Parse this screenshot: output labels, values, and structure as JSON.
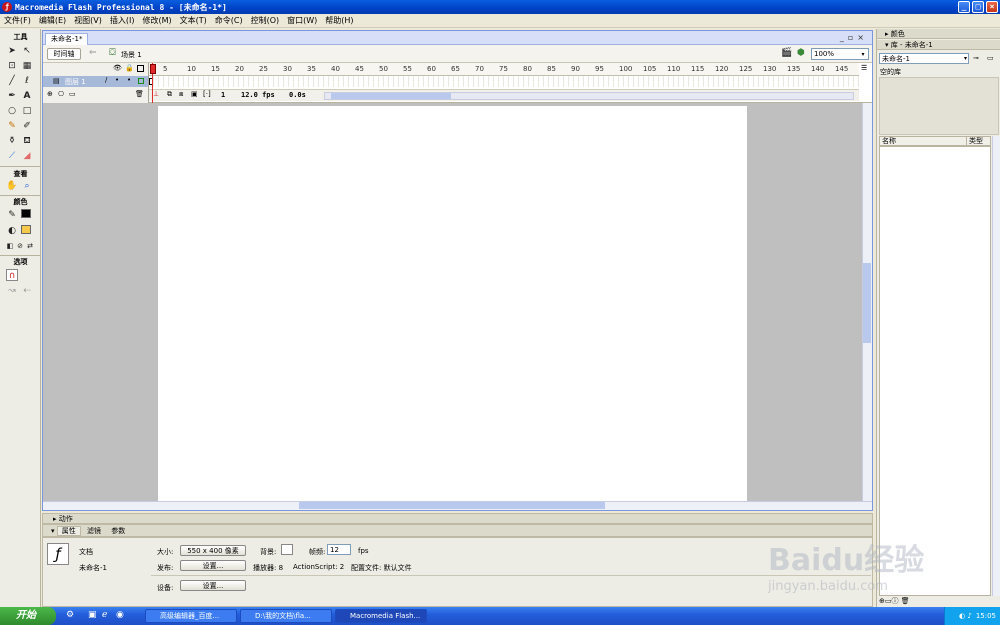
{
  "window": {
    "title": "Macromedia Flash Professional 8 - [未命名-1*]"
  },
  "menu": [
    "文件(F)",
    "编辑(E)",
    "视图(V)",
    "插入(I)",
    "修改(M)",
    "文本(T)",
    "命令(C)",
    "控制(O)",
    "窗口(W)",
    "帮助(H)"
  ],
  "tools": {
    "section_tools": "工具",
    "section_view": "查看",
    "section_colors": "颜色",
    "section_options": "选项"
  },
  "document": {
    "tab": "未命名-1*",
    "timeline_button": "时间轴",
    "scene": "场景 1",
    "zoom": "100%",
    "layer_name": "图层 1",
    "ruler_ticks": [
      "5",
      "10",
      "15",
      "20",
      "25",
      "30",
      "35",
      "40",
      "45",
      "50",
      "55",
      "60",
      "65",
      "70",
      "75",
      "80",
      "85",
      "90",
      "95",
      "100",
      "105",
      "110",
      "115",
      "120",
      "125",
      "130",
      "135",
      "140",
      "145"
    ],
    "status_frame": "1",
    "status_fps": "12.0 fps",
    "status_time": "0.0s"
  },
  "panels": {
    "actions": "动作",
    "tab_properties": "属性",
    "tab_filters": "滤镜",
    "tab_params": "参数"
  },
  "properties": {
    "type": "文档",
    "name": "未命名-1",
    "size_label": "大小:",
    "size_value": "550 x 400 像素",
    "bg_label": "背景:",
    "fps_label": "帧频:",
    "fps_value": "12",
    "fps_unit": "fps",
    "publish_label": "发布:",
    "settings_button": "设置...",
    "player": "播放器: 8",
    "actionscript": "ActionScript: 2",
    "profile": "配置文件: 默认文件",
    "device_label": "设备:",
    "device_button": "设置..."
  },
  "right": {
    "color_panel": "颜色",
    "library_panel": "库 - 未命名-1",
    "library_select": "未命名-1",
    "empty_library": "空的库",
    "col_name": "名称",
    "col_type": "类型"
  },
  "taskbar": {
    "start": "开始",
    "tasks": [
      "高级编辑器_百度...",
      "D:\\我的文档\\fla...",
      "Macromedia Flash..."
    ],
    "clock": "15:05"
  },
  "watermark": {
    "text": "Baidu经验",
    "url": "jingyan.baidu.com"
  }
}
